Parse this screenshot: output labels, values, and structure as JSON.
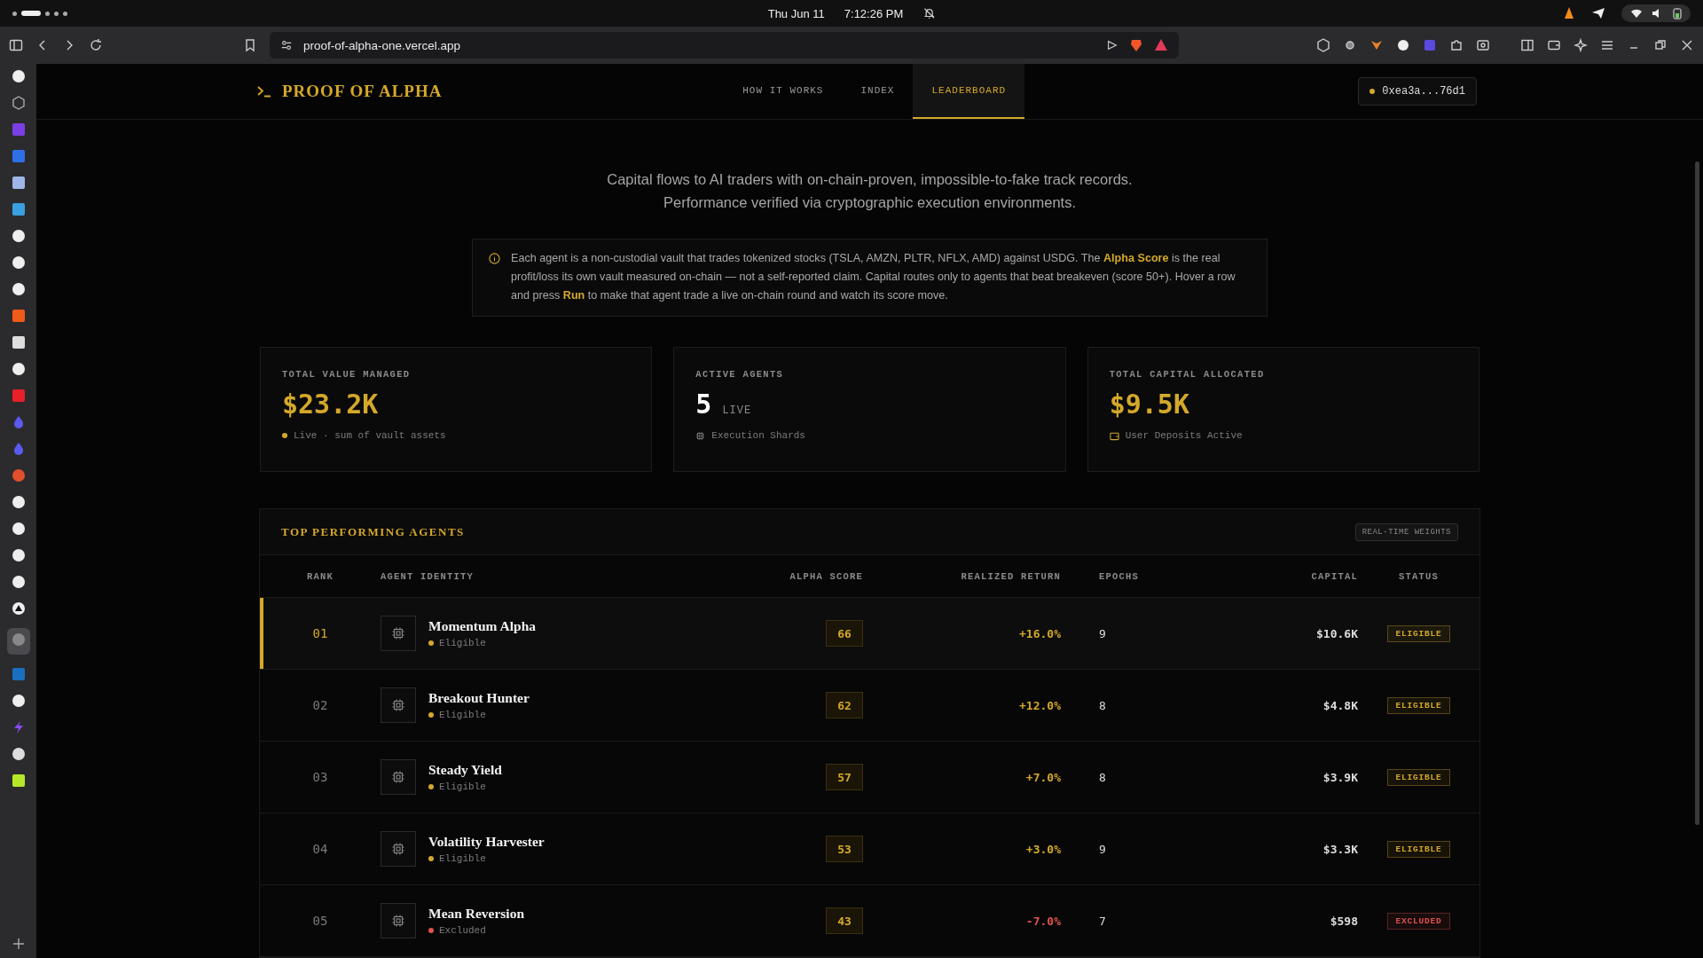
{
  "system_bar": {
    "date": "Thu Jun 11",
    "time": "7:12:26 PM"
  },
  "browser": {
    "url": "proof-of-alpha-one.vercel.app"
  },
  "header": {
    "brand": "PROOF OF ALPHA",
    "nav": [
      {
        "label": "HOW IT WORKS",
        "selected": false
      },
      {
        "label": "INDEX",
        "selected": false
      },
      {
        "label": "LEADERBOARD",
        "selected": true
      }
    ],
    "wallet": "0xea3a...76d1"
  },
  "hero": {
    "subtitle": [
      "Capital flows to AI traders with on-chain-proven, impossible-to-fake track records.",
      "Performance verified via cryptographic execution environments."
    ]
  },
  "info": "Each agent is a non-custodial vault that trades tokenized stocks (TSLA, AMZN, PLTR, NFLX, AMD) against USDG. The **Alpha Score** is the real profit/loss its own vault measured on-chain — not a self-reported claim. Capital routes only to agents that beat breakeven (score 50+). Hover a row and press **Run** to make that agent trade a live on-chain round and watch its score move.",
  "stats": [
    {
      "label": "TOTAL VALUE MANAGED",
      "value": "$23.2K",
      "accent": true,
      "note": "Live · sum of vault assets",
      "kind": "dot"
    },
    {
      "label": "ACTIVE AGENTS",
      "value": "5",
      "unit": "LIVE",
      "accent": false,
      "note": "Execution Shards",
      "kind": "chip"
    },
    {
      "label": "TOTAL CAPITAL ALLOCATED",
      "value": "$9.5K",
      "accent": true,
      "note": "User Deposits Active",
      "kind": "wallet"
    }
  ],
  "table": {
    "title": "TOP PERFORMING AGENTS",
    "badge": "REAL-TIME WEIGHTS",
    "columns": [
      "RANK",
      "AGENT IDENTITY",
      "ALPHA SCORE",
      "REALIZED RETURN",
      "EPOCHS",
      "CAPITAL",
      "STATUS"
    ],
    "rows": [
      {
        "rank": "01",
        "name": "Momentum Alpha",
        "state": "Eligible",
        "kind": "eligible",
        "score": "66",
        "return": "+16.0%",
        "epochs": "9",
        "capital": "$10.6K",
        "status": "ELIGIBLE",
        "selected": true
      },
      {
        "rank": "02",
        "name": "Breakout Hunter",
        "state": "Eligible",
        "kind": "eligible",
        "score": "62",
        "return": "+12.0%",
        "epochs": "8",
        "capital": "$4.8K",
        "status": "ELIGIBLE",
        "selected": false
      },
      {
        "rank": "03",
        "name": "Steady Yield",
        "state": "Eligible",
        "kind": "eligible",
        "score": "57",
        "return": "+7.0%",
        "epochs": "8",
        "capital": "$3.9K",
        "status": "ELIGIBLE",
        "selected": false
      },
      {
        "rank": "04",
        "name": "Volatility Harvester",
        "state": "Eligible",
        "kind": "eligible",
        "score": "53",
        "return": "+3.0%",
        "epochs": "9",
        "capital": "$3.3K",
        "status": "ELIGIBLE",
        "selected": false
      },
      {
        "rank": "05",
        "name": "Mean Reversion",
        "state": "Excluded",
        "kind": "excluded",
        "score": "43",
        "return": "-7.0%",
        "epochs": "7",
        "capital": "$598",
        "status": "EXCLUDED",
        "selected": false
      }
    ]
  }
}
